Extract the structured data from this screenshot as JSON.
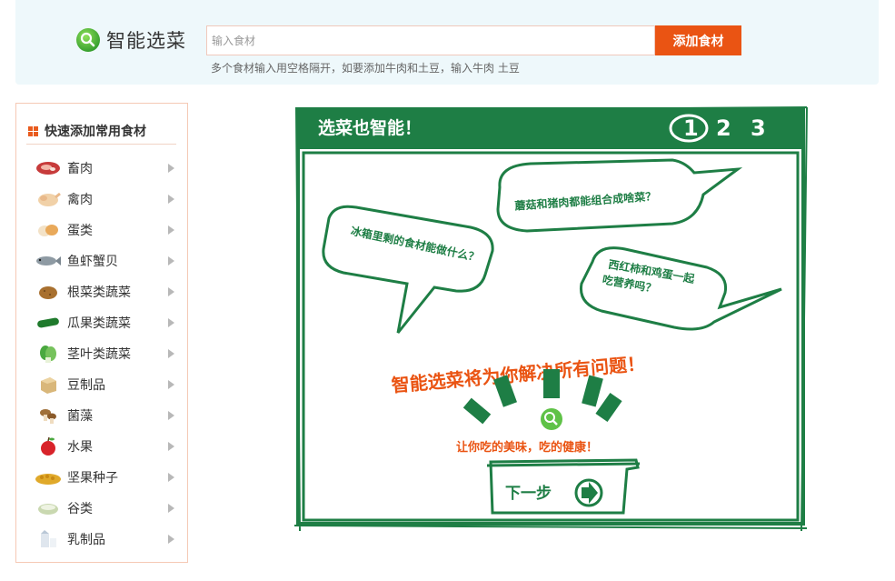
{
  "header": {
    "logo_text": "智能选菜",
    "search_placeholder": "输入食材",
    "add_button": "添加食材",
    "hint": "多个食材输入用空格隔开，如要添加牛肉和土豆，输入牛肉 土豆"
  },
  "sidebar": {
    "title": "快速添加常用食材",
    "items": [
      {
        "label": "畜肉",
        "icon": "meat-icon"
      },
      {
        "label": "禽肉",
        "icon": "chicken-icon"
      },
      {
        "label": "蛋类",
        "icon": "egg-icon"
      },
      {
        "label": "鱼虾蟹贝",
        "icon": "fish-icon"
      },
      {
        "label": "根菜类蔬菜",
        "icon": "potato-icon"
      },
      {
        "label": "瓜果类蔬菜",
        "icon": "cucumber-icon"
      },
      {
        "label": "茎叶类蔬菜",
        "icon": "greens-icon"
      },
      {
        "label": "豆制品",
        "icon": "tofu-icon"
      },
      {
        "label": "菌藻",
        "icon": "mushroom-icon"
      },
      {
        "label": "水果",
        "icon": "apple-icon"
      },
      {
        "label": "坚果种子",
        "icon": "nuts-icon"
      },
      {
        "label": "谷类",
        "icon": "grain-icon"
      },
      {
        "label": "乳制品",
        "icon": "milk-icon"
      }
    ]
  },
  "board": {
    "title": "选菜也智能！",
    "steps": [
      "1",
      "2",
      "3"
    ],
    "bubble1": "蘑菇和猪肉都能组合成啥菜？",
    "bubble2": "冰箱里剩的食材能做什么？",
    "bubble3_line1": "西红柿和鸡蛋一起",
    "bubble3_line2": "吃营养吗？",
    "headline": "智能选菜将为你解决所有问题！",
    "tagline": "让你吃的美味，吃的健康！",
    "next_button": "下一步"
  },
  "colors": {
    "accent_orange": "#ea5413",
    "board_green": "#1e7e45",
    "header_bg": "#eef8fb"
  }
}
